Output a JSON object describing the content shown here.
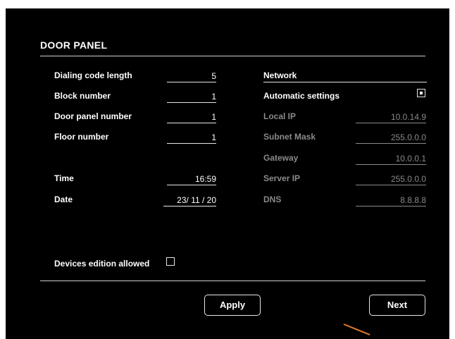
{
  "panel": {
    "title": "DOOR PANEL"
  },
  "left": {
    "dialing_code_length": {
      "label": "Dialing code length",
      "value": "5"
    },
    "block_number": {
      "label": "Block number",
      "value": "1"
    },
    "door_panel_number": {
      "label": "Door panel number",
      "value": "1"
    },
    "floor_number": {
      "label": "Floor number",
      "value": "1"
    },
    "time": {
      "label": "Time",
      "value": "16:59"
    },
    "date": {
      "label": "Date",
      "value": "23/ 11 / 20"
    },
    "devices_edition": {
      "label": "Devices edition allowed",
      "checked": false
    }
  },
  "network": {
    "header": "Network",
    "automatic_settings": {
      "label": "Automatic settings",
      "selected": true
    },
    "local_ip": {
      "label": "Local IP",
      "value": "10.0.14.9"
    },
    "subnet_mask": {
      "label": "Subnet Mask",
      "value": "255.0.0.0"
    },
    "gateway": {
      "label": "Gateway",
      "value": "10.0.0.1"
    },
    "server_ip": {
      "label": "Server IP",
      "value": "255.0.0.0"
    },
    "dns": {
      "label": "DNS",
      "value": "8.8.8.8"
    }
  },
  "buttons": {
    "apply": "Apply",
    "next": "Next"
  },
  "colors": {
    "background": "#000000",
    "text": "#ffffff",
    "disabled": "#8a8a8a",
    "cursor": "#e07a2e"
  }
}
